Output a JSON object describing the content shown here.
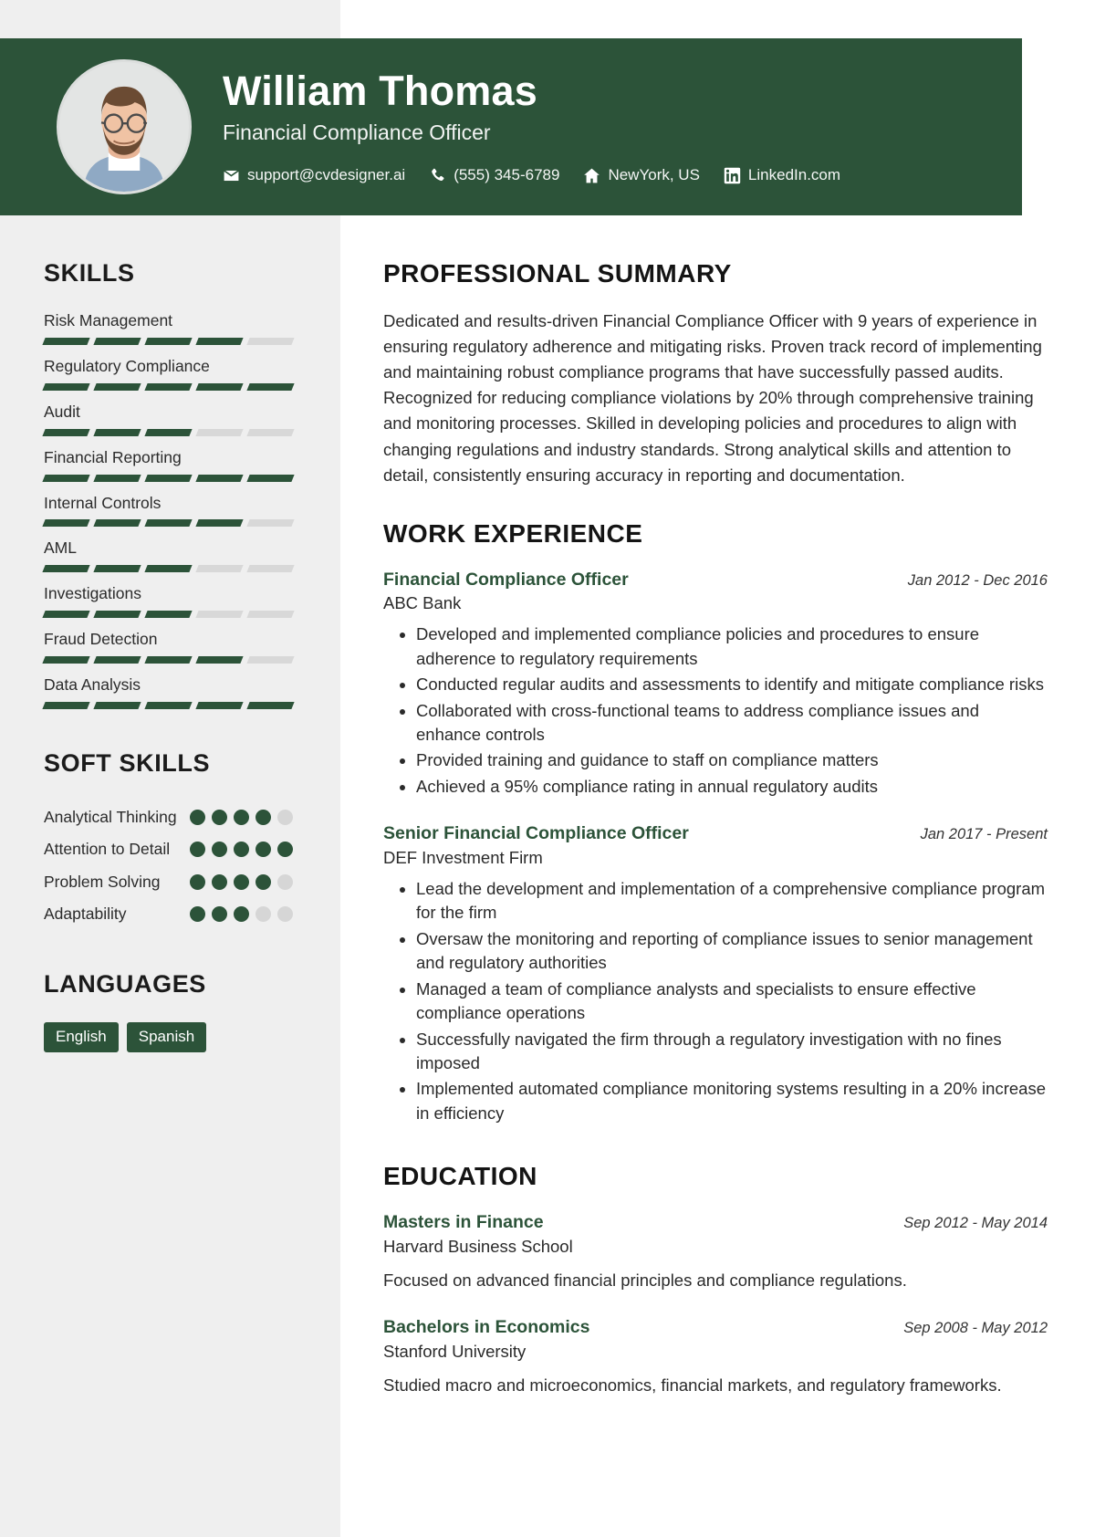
{
  "header": {
    "name": "William Thomas",
    "role": "Financial Compliance Officer",
    "avatar_alt": "profile-photo",
    "contacts": [
      {
        "icon": "envelope-icon",
        "text": "support@cvdesigner.ai"
      },
      {
        "icon": "phone-icon",
        "text": "(555) 345-6789"
      },
      {
        "icon": "home-icon",
        "text": "NewYork, US"
      },
      {
        "icon": "linkedin-icon",
        "text": "LinkedIn.com"
      }
    ],
    "accent_green": "#2c5339",
    "text_on_accent": "#ffffff"
  },
  "sidebar": {
    "skills_heading": "SKILLS",
    "skills": [
      {
        "name": "Risk Management",
        "level": 4,
        "max": 5
      },
      {
        "name": "Regulatory Compliance",
        "level": 5,
        "max": 5
      },
      {
        "name": "Audit",
        "level": 3,
        "max": 5
      },
      {
        "name": "Financial Reporting",
        "level": 5,
        "max": 5
      },
      {
        "name": "Internal Controls",
        "level": 4,
        "max": 5
      },
      {
        "name": "AML",
        "level": 3,
        "max": 5
      },
      {
        "name": "Investigations",
        "level": 3,
        "max": 5
      },
      {
        "name": "Fraud Detection",
        "level": 4,
        "max": 5
      },
      {
        "name": "Data Analysis",
        "level": 5,
        "max": 5
      }
    ],
    "soft_skills_heading": "SOFT SKILLS",
    "soft_skills": [
      {
        "name": "Analytical Thinking",
        "level": 4,
        "max": 5
      },
      {
        "name": "Attention to Detail",
        "level": 5,
        "max": 5
      },
      {
        "name": "Problem Solving",
        "level": 4,
        "max": 5
      },
      {
        "name": "Adaptability",
        "level": 3,
        "max": 5
      }
    ],
    "languages_heading": "LANGUAGES",
    "languages": [
      "English",
      "Spanish"
    ],
    "bar_on_color": "#2c5339",
    "bar_off_color": "#d8d8d8",
    "background": "#efefef"
  },
  "main": {
    "summary_heading": "PROFESSIONAL SUMMARY",
    "summary_text": "Dedicated and results-driven Financial Compliance Officer with 9 years of experience in ensuring regulatory adherence and mitigating risks. Proven track record of implementing and maintaining robust compliance programs that have successfully passed audits. Recognized for reducing compliance violations by 20% through comprehensive training and monitoring processes. Skilled in developing policies and procedures to align with changing regulations and industry standards. Strong analytical skills and attention to detail, consistently ensuring accuracy in reporting and documentation.",
    "experience_heading": "WORK EXPERIENCE",
    "experience": [
      {
        "title": "Financial Compliance Officer",
        "date": "Jan 2012 - Dec 2016",
        "organization": "ABC Bank",
        "bullets": [
          "Developed and implemented compliance policies and procedures to ensure adherence to regulatory requirements",
          "Conducted regular audits and assessments to identify and mitigate compliance risks",
          "Collaborated with cross-functional teams to address compliance issues and enhance controls",
          "Provided training and guidance to staff on compliance matters",
          "Achieved a 95% compliance rating in annual regulatory audits"
        ]
      },
      {
        "title": "Senior Financial Compliance Officer",
        "date": "Jan 2017 - Present",
        "organization": "DEF Investment Firm",
        "bullets": [
          "Lead the development and implementation of a comprehensive compliance program for the firm",
          "Oversaw the monitoring and reporting of compliance issues to senior management and regulatory authorities",
          "Managed a team of compliance analysts and specialists to ensure effective compliance operations",
          "Successfully navigated the firm through a regulatory investigation with no fines imposed",
          "Implemented automated compliance monitoring systems resulting in a 20% increase in efficiency"
        ]
      }
    ],
    "education_heading": "EDUCATION",
    "education": [
      {
        "degree": "Masters in Finance",
        "date": "Sep 2012 - May 2014",
        "school": "Harvard Business School",
        "description": "Focused on advanced financial principles and compliance regulations."
      },
      {
        "degree": "Bachelors in Economics",
        "date": "Sep 2008 - May 2012",
        "school": "Stanford University",
        "description": "Studied macro and microeconomics, financial markets, and regulatory frameworks."
      }
    ],
    "entry_title_color": "#2c5339"
  }
}
